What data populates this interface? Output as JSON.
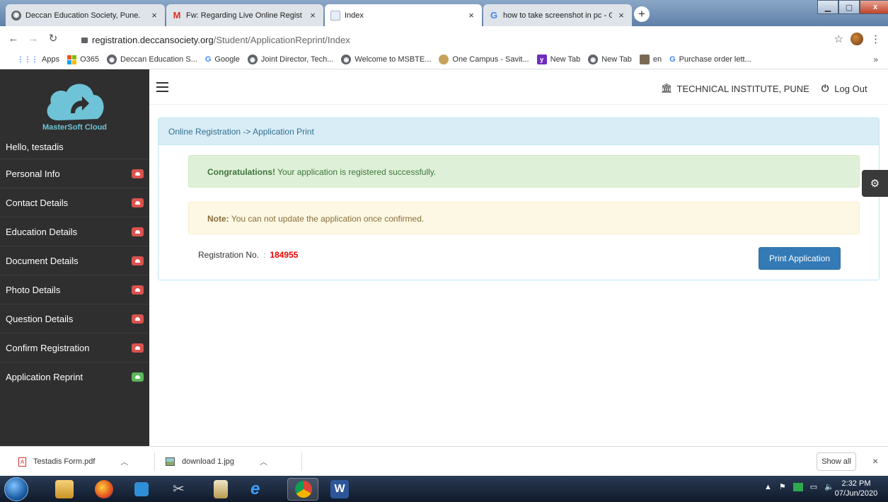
{
  "browser": {
    "tabs": [
      {
        "title": "Deccan Education Society, Pune.",
        "close": "×"
      },
      {
        "title": "Fw: Regarding Live Online Regist",
        "close": "×"
      },
      {
        "title": "Index",
        "close": "×"
      },
      {
        "title": "how to take screenshot in pc - G",
        "close": "×"
      }
    ],
    "new_tab": "+",
    "window_buttons": {
      "minimize": "▁",
      "maximize": "▢",
      "close": "x"
    },
    "url_domain": "registration.deccansociety.org",
    "url_path": "/Student/ApplicationReprint/Index",
    "bookmarks": [
      "Apps",
      "O365",
      "Deccan Education S...",
      "Google",
      "Joint Director, Tech...",
      "Welcome to MSBTE...",
      "One Campus - Savit...",
      "New Tab",
      "New Tab",
      "en",
      "Purchase order lett..."
    ],
    "bookmarks_more": "»"
  },
  "sidebar": {
    "logo_text": "MasterSoft Cloud",
    "greeting": "Hello, testadis",
    "items": [
      {
        "label": "Personal Info",
        "status": "incomplete"
      },
      {
        "label": "Contact Details",
        "status": "incomplete"
      },
      {
        "label": "Education Details",
        "status": "incomplete"
      },
      {
        "label": "Document Details",
        "status": "incomplete"
      },
      {
        "label": "Photo Details",
        "status": "incomplete"
      },
      {
        "label": "Question Details",
        "status": "incomplete"
      },
      {
        "label": "Confirm Registration",
        "status": "incomplete"
      },
      {
        "label": "Application Reprint",
        "status": "active"
      }
    ]
  },
  "header": {
    "institute": "TECHNICAL INSTITUTE, PUNE",
    "logout": "Log Out"
  },
  "panel": {
    "breadcrumb": "Online Registration -> Application Print",
    "success_strong": "Congratulations!",
    "success_text": " Your application is registered successfully.",
    "note_strong": "Note:",
    "note_text": " You can not update the application once confirmed.",
    "reg_label": "Registration No.",
    "reg_sep": ":",
    "reg_value": "184955",
    "print_button": "Print Application"
  },
  "downloads": {
    "items": [
      "Testadis Form.pdf",
      "download 1.jpg"
    ],
    "show_all": "Show all",
    "close": "×"
  },
  "taskbar": {
    "time": "2:32 PM",
    "date": "07/Jun/2020"
  },
  "colors": {
    "sidebar_bg": "#2f2f2f",
    "badge_red": "#d9534f",
    "badge_green": "#5cb85c",
    "primary": "#337ab7",
    "info_bg": "#d9edf7",
    "success_bg": "#dff0d8",
    "warning_bg": "#fcf8e3",
    "reg_value": "#ee0000"
  }
}
